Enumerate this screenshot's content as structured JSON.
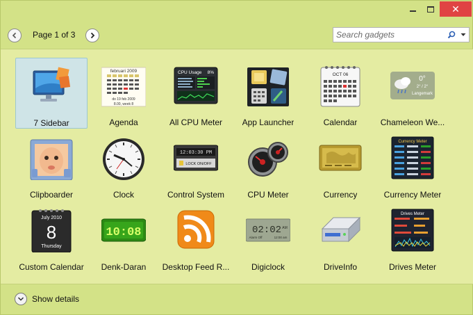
{
  "window": {
    "controls": {
      "minimize": "",
      "maximize": "",
      "close": "✕"
    }
  },
  "toolbar": {
    "page_label": "Page 1 of 3",
    "prev_icon": "‹",
    "next_icon": "›",
    "search": {
      "placeholder": "Search gadgets",
      "value": ""
    }
  },
  "gadgets": [
    {
      "label": "7 Sidebar",
      "icon": "monitor-icon",
      "selected": true
    },
    {
      "label": "Agenda",
      "icon": "calendar-list-icon"
    },
    {
      "label": "All CPU Meter",
      "icon": "cpu-usage-icon"
    },
    {
      "label": "App Launcher",
      "icon": "app-launcher-icon"
    },
    {
      "label": "Calendar",
      "icon": "calendar-icon"
    },
    {
      "label": "Chameleon We...",
      "icon": "weather-icon"
    },
    {
      "label": "Clipboarder",
      "icon": "clipboard-photo-icon"
    },
    {
      "label": "Clock",
      "icon": "clock-icon"
    },
    {
      "label": "Control System",
      "icon": "control-system-icon"
    },
    {
      "label": "CPU Meter",
      "icon": "cpu-meter-icon"
    },
    {
      "label": "Currency",
      "icon": "currency-icon"
    },
    {
      "label": "Currency Meter",
      "icon": "currency-meter-icon"
    },
    {
      "label": "Custom Calendar",
      "icon": "custom-calendar-icon"
    },
    {
      "label": "Denk-Daran",
      "icon": "digital-clock-icon"
    },
    {
      "label": "Desktop Feed R...",
      "icon": "rss-icon"
    },
    {
      "label": "Digiclock",
      "icon": "digiclock-icon"
    },
    {
      "label": "DriveInfo",
      "icon": "drive-icon"
    },
    {
      "label": "Drives Meter",
      "icon": "drives-meter-icon"
    }
  ],
  "icon_text": {
    "agenda_month": "februari 2009",
    "agenda_footer": "do 19 feb 2009",
    "agenda_week": "8.00, week 8",
    "cpu_title": "CPU Usage",
    "cpu_pct": "8%",
    "calendar_month": "OCT 06",
    "weather_temp": "0°",
    "weather_range": "2° / 2°",
    "weather_place": "Langemark",
    "control_time": "12:03:30 PM",
    "control_lock": "LOCK ON/OFF",
    "currency_meter_title": "Currency Meter",
    "custom_cal_month": "July 2010",
    "custom_cal_day": "8",
    "custom_cal_weekday": "Thursday",
    "denk_time": "10:08",
    "digiclock_time": "02:02",
    "digiclock_ampm": "AM",
    "digiclock_alarm": "Alarm Off",
    "digiclock_alarm_time": "12:00 am",
    "drives_meter_title": "Drives Meter"
  },
  "footer": {
    "details_label": "Show details",
    "chevron": "⌄"
  },
  "colors": {
    "window_bg": "#d3e287",
    "gallery_bg": "#e4eca2",
    "selection": "#cfe4e7",
    "close_red": "#e04343"
  }
}
